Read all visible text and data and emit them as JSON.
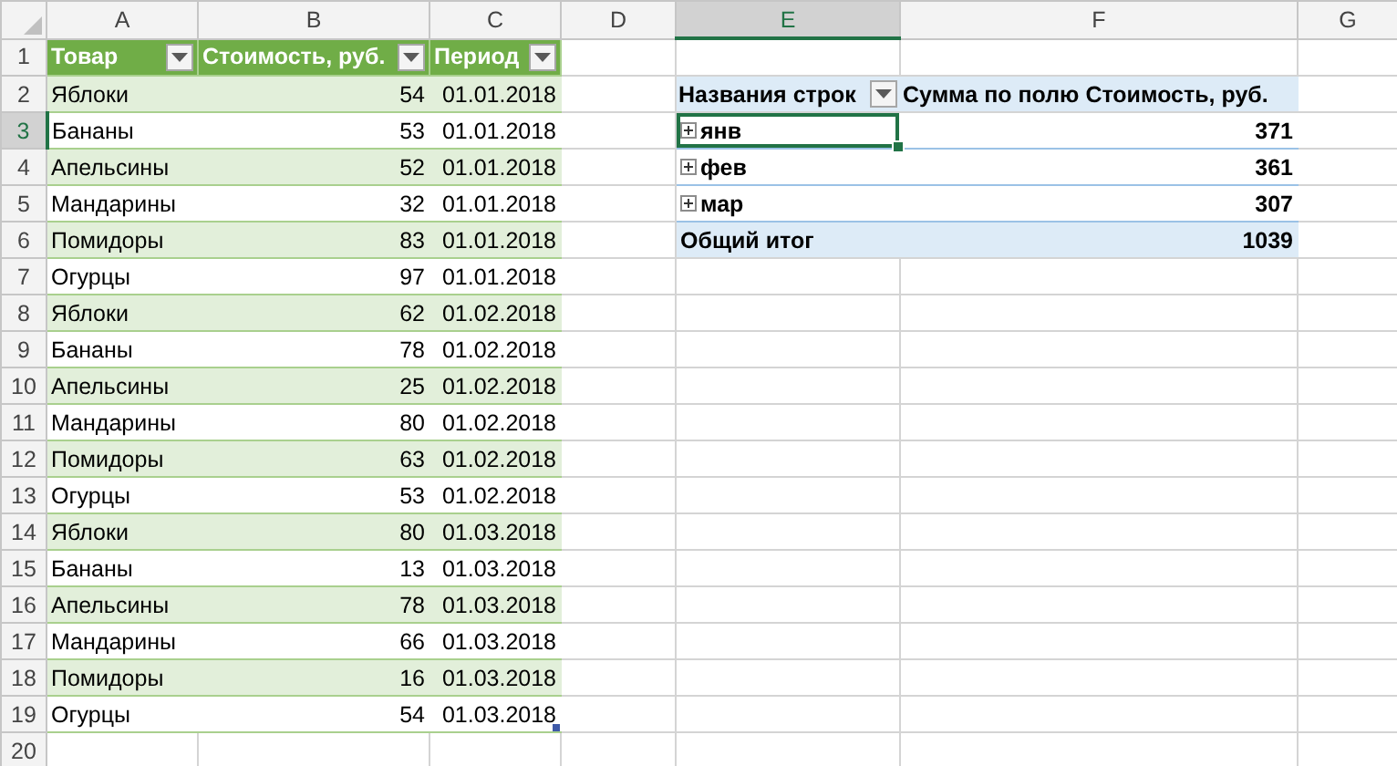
{
  "sheet": {
    "columns": [
      "A",
      "B",
      "C",
      "D",
      "E",
      "F",
      "G"
    ],
    "rows": [
      "1",
      "2",
      "3",
      "4",
      "5",
      "6",
      "7",
      "8",
      "9",
      "10",
      "11",
      "12",
      "13",
      "14",
      "15",
      "16",
      "17",
      "18",
      "19",
      "20"
    ]
  },
  "table": {
    "headers": [
      "Товар",
      "Стоимость, руб.",
      "Период"
    ],
    "rows": [
      [
        "Яблоки",
        "54",
        "01.01.2018"
      ],
      [
        "Бананы",
        "53",
        "01.01.2018"
      ],
      [
        "Апельсины",
        "52",
        "01.01.2018"
      ],
      [
        "Мандарины",
        "32",
        "01.01.2018"
      ],
      [
        "Помидоры",
        "83",
        "01.01.2018"
      ],
      [
        "Огурцы",
        "97",
        "01.01.2018"
      ],
      [
        "Яблоки",
        "62",
        "01.02.2018"
      ],
      [
        "Бананы",
        "78",
        "01.02.2018"
      ],
      [
        "Апельсины",
        "25",
        "01.02.2018"
      ],
      [
        "Мандарины",
        "80",
        "01.02.2018"
      ],
      [
        "Помидоры",
        "63",
        "01.02.2018"
      ],
      [
        "Огурцы",
        "53",
        "01.02.2018"
      ],
      [
        "Яблоки",
        "80",
        "01.03.2018"
      ],
      [
        "Бананы",
        "13",
        "01.03.2018"
      ],
      [
        "Апельсины",
        "78",
        "01.03.2018"
      ],
      [
        "Мандарины",
        "66",
        "01.03.2018"
      ],
      [
        "Помидоры",
        "16",
        "01.03.2018"
      ],
      [
        "Огурцы",
        "54",
        "01.03.2018"
      ]
    ]
  },
  "pivot": {
    "row_label_header": "Названия строк",
    "value_header": "Сумма по полю Стоимость, руб.",
    "rows": [
      {
        "label": "янв",
        "value": "371",
        "expanded": false,
        "selected": true
      },
      {
        "label": "фев",
        "value": "361",
        "expanded": false,
        "selected": false
      },
      {
        "label": "мар",
        "value": "307",
        "expanded": false,
        "selected": false
      }
    ],
    "total": {
      "label": "Общий итог",
      "value": "1039"
    }
  }
}
